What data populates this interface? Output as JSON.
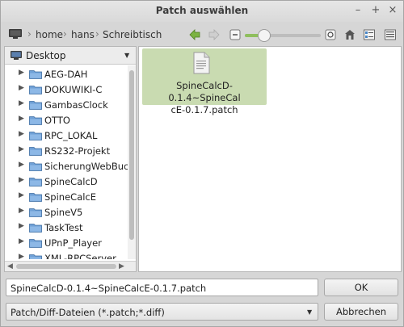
{
  "window": {
    "title": "Patch auswählen",
    "controls": {
      "minimize": "–",
      "maximize": "+",
      "close": "×"
    }
  },
  "pathbar": {
    "crumbs": [
      "home",
      "hans",
      "Schreibtisch"
    ],
    "separator": "›",
    "zoom_level": 0.25
  },
  "sidebar": {
    "location": "Desktop",
    "dropdown_glyph": "▼",
    "expander_glyph": "▶",
    "items": [
      {
        "label": "AEG-DAH"
      },
      {
        "label": "DOKUWIKI-C"
      },
      {
        "label": "GambasClock"
      },
      {
        "label": "OTTO"
      },
      {
        "label": "RPC_LOKAL"
      },
      {
        "label": "RS232-Projekt"
      },
      {
        "label": "SicherungWebBuch"
      },
      {
        "label": "SpineCalcD"
      },
      {
        "label": "SpineCalcE"
      },
      {
        "label": "SpineV5"
      },
      {
        "label": "TaskTest"
      },
      {
        "label": "UPnP_Player"
      },
      {
        "label": "XML-RPCServer"
      }
    ],
    "scroll_left": "◀",
    "scroll_right": "▶"
  },
  "files": [
    {
      "name_line1": "SpineCalcD-0.1.4~SpineCal",
      "name_line2": "cE-0.1.7.patch",
      "selected": true
    }
  ],
  "filename_field": {
    "value": "SpineCalcD-0.1.4~SpineCalcE-0.1.7.patch"
  },
  "filter_select": {
    "value": "Patch/Diff-Dateien (*.patch;*.diff)",
    "arrow": "▼"
  },
  "buttons": {
    "ok": "OK",
    "cancel": "Abbrechen"
  },
  "colors": {
    "accent_green": "#8fbf5e",
    "selection": "#c9dbb1",
    "folder": "#6fa0d6"
  }
}
